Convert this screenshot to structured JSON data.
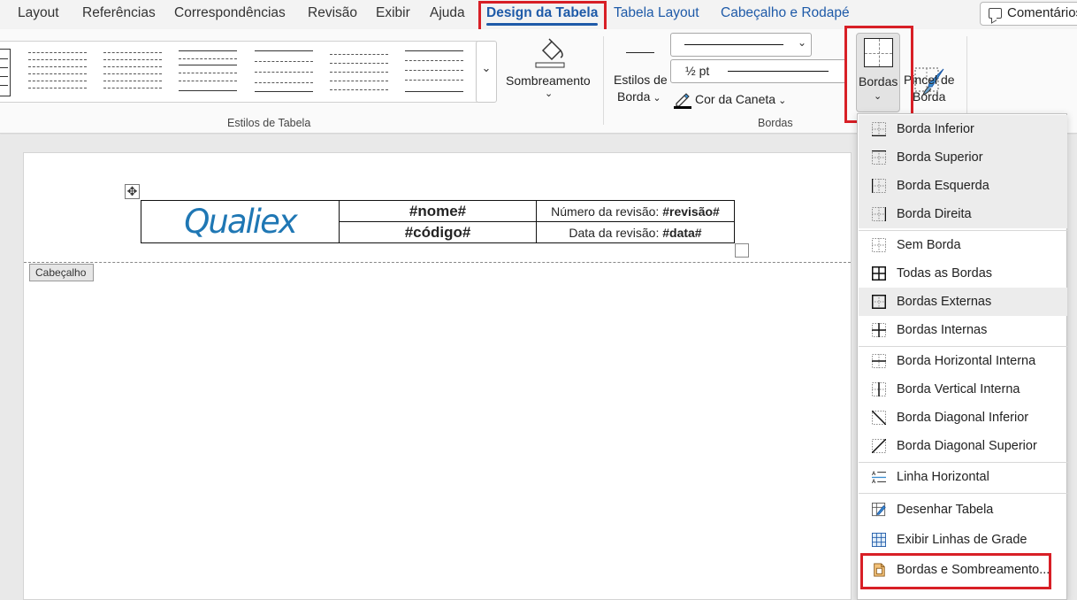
{
  "tabs": [
    {
      "label": "Layout",
      "state": "normal"
    },
    {
      "label": "Referências",
      "state": "normal"
    },
    {
      "label": "Correspondências",
      "state": "normal"
    },
    {
      "label": "Revisão",
      "state": "normal"
    },
    {
      "label": "Exibir",
      "state": "normal"
    },
    {
      "label": "Ajuda",
      "state": "normal"
    },
    {
      "label": "Design da Tabela",
      "state": "active"
    },
    {
      "label": "Tabela Layout",
      "state": "contextual"
    },
    {
      "label": "Cabeçalho e Rodapé",
      "state": "contextual"
    }
  ],
  "comments_label": "Comentários",
  "ribbon": {
    "group_table_styles": "Estilos de Tabela",
    "shading_label": "Sombreamento",
    "border_styles_label_1": "Estilos de",
    "border_styles_label_2": "Borda",
    "pen_weight": "½ pt",
    "pen_color_label": "Cor da Caneta",
    "group_borders": "Bordas",
    "borders_button": "Bordas",
    "border_painter_1": "Pincel de",
    "border_painter_2": "Borda"
  },
  "document": {
    "logo_text": "Qualiex",
    "name_field": "#nome#",
    "code_field": "#código#",
    "revision_number_label": "Número da revisão: ",
    "revision_number_value": "#revisão#",
    "revision_date_label": "Data da revisão: ",
    "revision_date_value": "#data#",
    "header_tag": "Cabeçalho"
  },
  "borders_menu": {
    "items": [
      {
        "label": "Borda Inferior",
        "icon": "border-bottom-icon"
      },
      {
        "label": "Borda Superior",
        "icon": "border-top-icon"
      },
      {
        "label": "Borda Esquerda",
        "icon": "border-left-icon"
      },
      {
        "label": "Borda Direita",
        "icon": "border-right-icon"
      },
      {
        "label": "Sem Borda",
        "icon": "no-border-icon"
      },
      {
        "label": "Todas as Bordas",
        "icon": "all-borders-icon"
      },
      {
        "label": "Bordas Externas",
        "icon": "outside-borders-icon"
      },
      {
        "label": "Bordas Internas",
        "icon": "inside-borders-icon"
      },
      {
        "label": "Borda Horizontal Interna",
        "icon": "inside-horizontal-border-icon"
      },
      {
        "label": "Borda Vertical Interna",
        "icon": "inside-vertical-border-icon"
      },
      {
        "label": "Borda Diagonal Inferior",
        "icon": "diagonal-down-border-icon"
      },
      {
        "label": "Borda Diagonal Superior",
        "icon": "diagonal-up-border-icon"
      },
      {
        "label": "Linha Horizontal",
        "icon": "horizontal-line-icon"
      },
      {
        "label": "Desenhar Tabela",
        "icon": "draw-table-icon"
      },
      {
        "label": "Exibir Linhas de Grade",
        "icon": "view-gridlines-icon"
      },
      {
        "label": "Bordas e Sombreamento...",
        "icon": "borders-and-shading-icon"
      }
    ]
  },
  "colors": {
    "accent": "#1e5aa8",
    "highlight": "#d81f26",
    "logo": "#1f77b4"
  }
}
